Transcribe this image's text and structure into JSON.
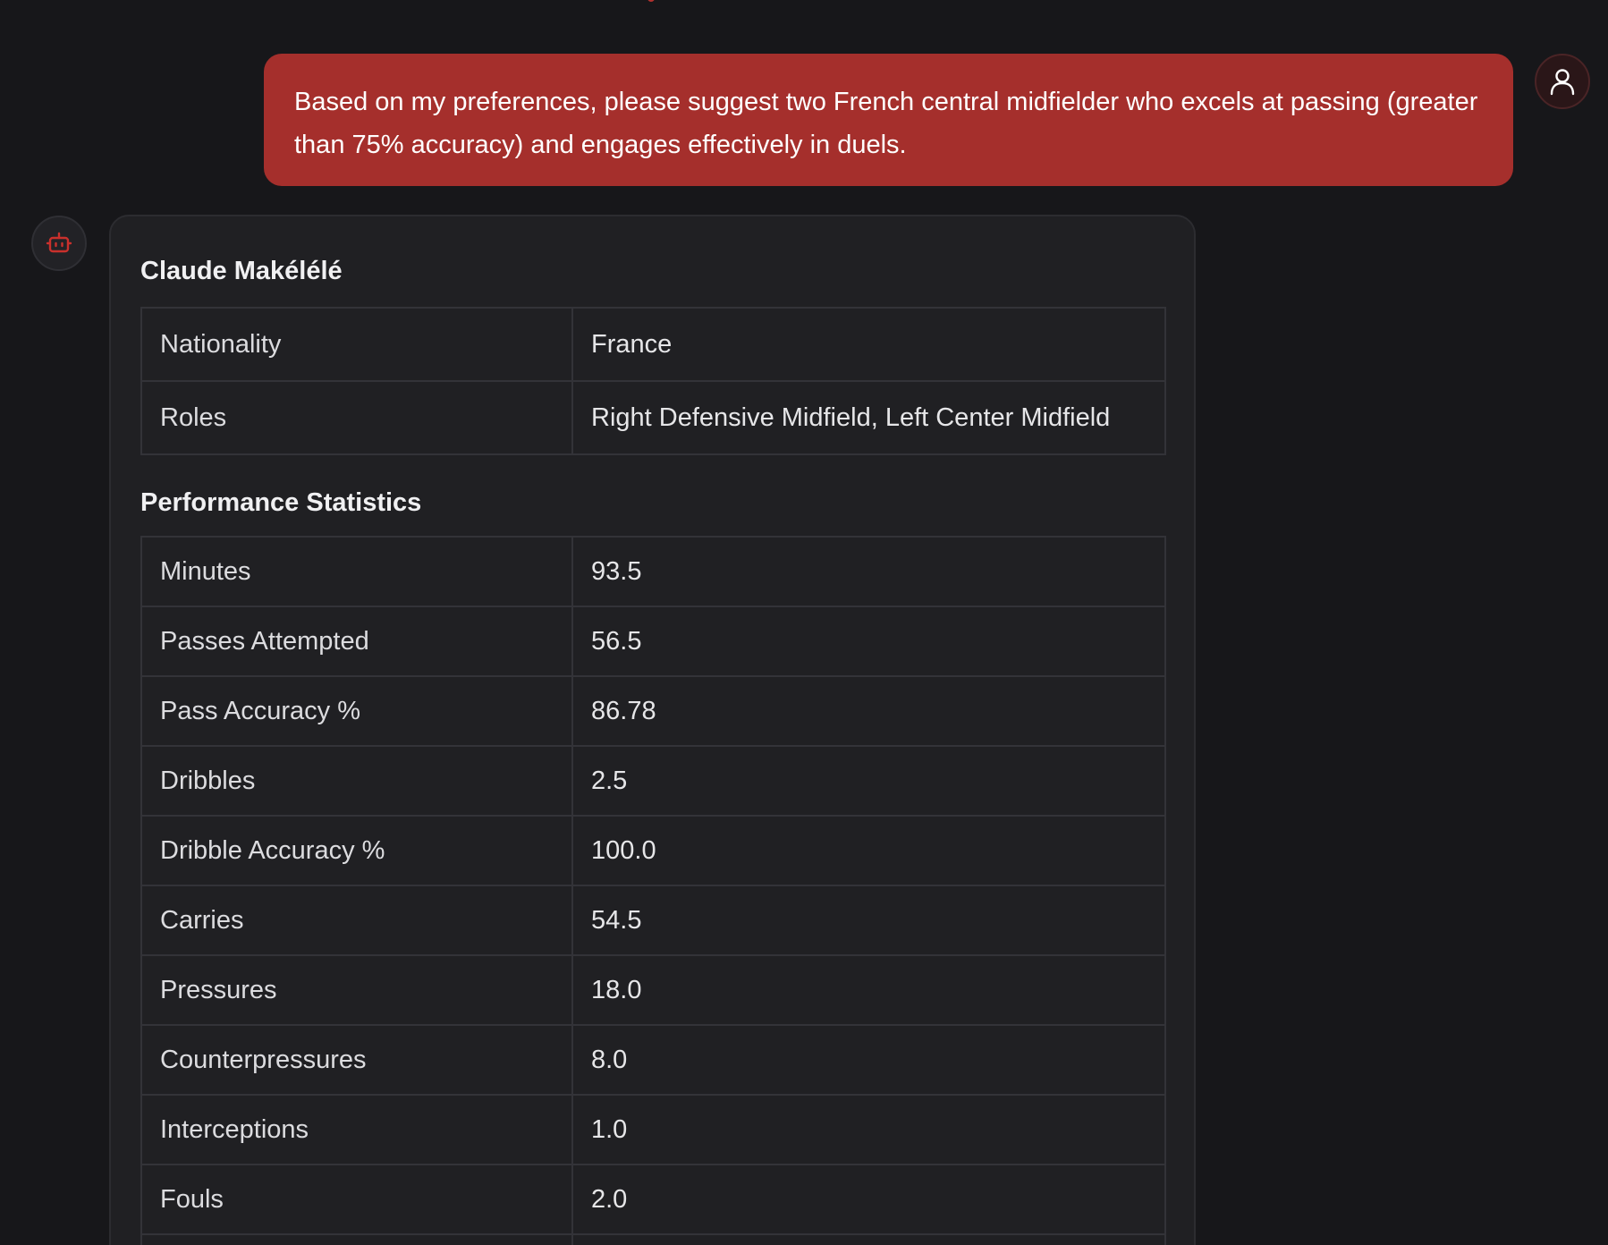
{
  "colors": {
    "background": "#17171a",
    "user_bubble": "#a52f2c",
    "card": "#202023",
    "accent": "#c9302c"
  },
  "icons": {
    "user_avatar": "user-icon",
    "bot_avatar": "robot-icon"
  },
  "user_message": {
    "text": "Based on my preferences, please suggest two French central midfielder who excels at passing (greater than 75% accuracy) and engages effectively in duels."
  },
  "assistant": {
    "player_name": "Claude Makélélé",
    "info": [
      {
        "label": "Nationality",
        "value": "France"
      },
      {
        "label": "Roles",
        "value": "Right Defensive Midfield, Left Center Midfield"
      }
    ],
    "stats_heading": "Performance Statistics",
    "stats": [
      {
        "label": "Minutes",
        "value": "93.5"
      },
      {
        "label": "Passes Attempted",
        "value": "56.5"
      },
      {
        "label": "Pass Accuracy %",
        "value": "86.78"
      },
      {
        "label": "Dribbles",
        "value": "2.5"
      },
      {
        "label": "Dribble Accuracy %",
        "value": "100.0"
      },
      {
        "label": "Carries",
        "value": "54.5"
      },
      {
        "label": "Pressures",
        "value": "18.0"
      },
      {
        "label": "Counterpressures",
        "value": "8.0"
      },
      {
        "label": "Interceptions",
        "value": "1.0"
      },
      {
        "label": "Fouls",
        "value": "2.0"
      },
      {
        "label": "",
        "value": ""
      }
    ]
  }
}
